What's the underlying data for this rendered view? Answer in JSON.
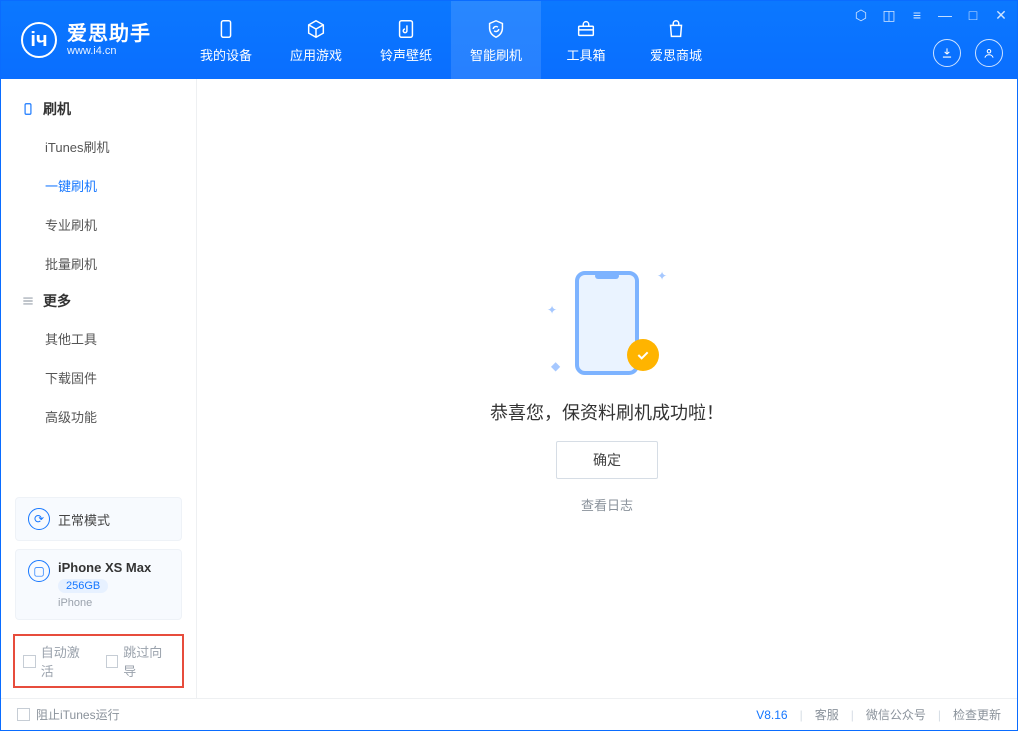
{
  "app": {
    "title": "爱思助手",
    "subtitle": "www.i4.cn"
  },
  "tabs": {
    "device": "我的设备",
    "apps": "应用游戏",
    "ring": "铃声壁纸",
    "flash": "智能刷机",
    "tools": "工具箱",
    "store": "爱思商城"
  },
  "sidebar": {
    "section_flash": "刷机",
    "items_flash": {
      "itunes": "iTunes刷机",
      "oneclick": "一键刷机",
      "pro": "专业刷机",
      "batch": "批量刷机"
    },
    "section_more": "更多",
    "items_more": {
      "other": "其他工具",
      "firmware": "下载固件",
      "adv": "高级功能"
    },
    "mode": "正常模式",
    "device": {
      "name": "iPhone XS Max",
      "capacity": "256GB",
      "type": "iPhone"
    },
    "auto_activate": "自动激活",
    "skip_guide": "跳过向导"
  },
  "main": {
    "message": "恭喜您，保资料刷机成功啦！",
    "ok": "确定",
    "view_log": "查看日志"
  },
  "footer": {
    "block_itunes": "阻止iTunes运行",
    "version": "V8.16",
    "service": "客服",
    "wechat": "微信公众号",
    "update": "检查更新"
  }
}
